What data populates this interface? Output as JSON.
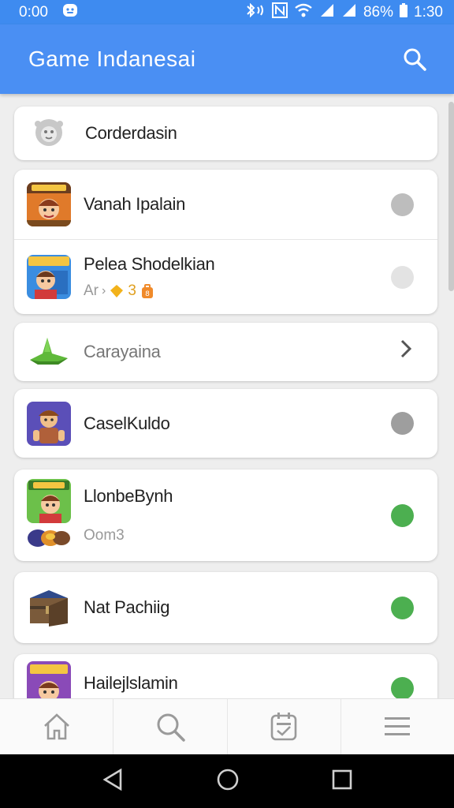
{
  "status_bar": {
    "time": "0:00",
    "battery": "86%",
    "clock": "1:30"
  },
  "app_bar": {
    "title": "Game Indanesai"
  },
  "list": {
    "item1": {
      "label": "Corderdasin",
      "icon": "face-icon"
    },
    "group1": {
      "row1": {
        "label": "Vanah Ipalain",
        "dot_color": "#bdbdbd"
      },
      "row2": {
        "label": "Pelea Shodelkian",
        "sub": "Ar",
        "sub_extra": "3",
        "dot_color": "#e3e3e3"
      }
    },
    "item2": {
      "label": "Carayaina",
      "icon": "leaf-icon"
    },
    "item3": {
      "label": "CaselKuldo",
      "dot_color": "#9e9e9e"
    },
    "item4": {
      "label": "LlonbeBynh",
      "sub": "Oom3",
      "dot_color": "#4caf50"
    },
    "item5": {
      "label": "Nat Pachiig",
      "dot_color": "#4caf50"
    },
    "item6": {
      "label": "Hailejlslamin",
      "dot_color": "#4caf50"
    }
  },
  "bottom_nav": [
    "home-icon",
    "search-icon",
    "calendar-icon",
    "menu-icon"
  ],
  "colors": {
    "primary": "#4a8ff3",
    "status": "#3e8bf0",
    "green": "#4caf50"
  }
}
